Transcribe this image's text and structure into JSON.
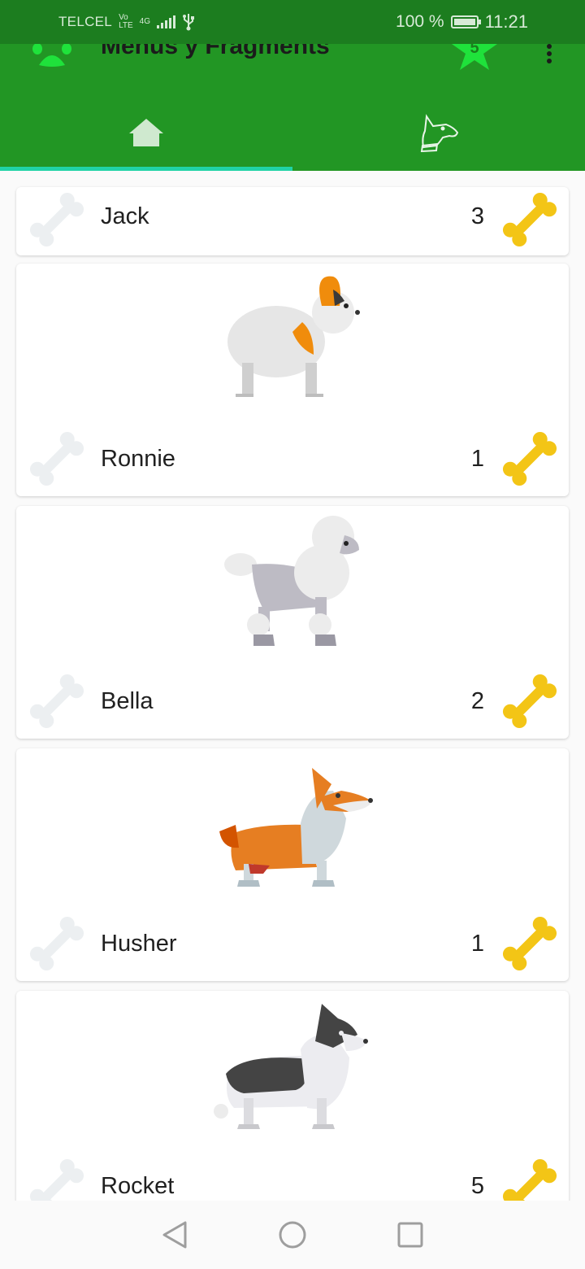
{
  "status_bar": {
    "carrier": "TELCEL",
    "volte_top": "Vo",
    "volte_bottom": "LTE",
    "network": "4G",
    "battery": "100 %",
    "time": "11:21"
  },
  "app_bar": {
    "title": "Menus y Fragments",
    "badge_count": "5",
    "tabs": [
      {
        "icon": "home-icon",
        "selected": true
      },
      {
        "icon": "dog-head-icon",
        "selected": false
      }
    ]
  },
  "colors": {
    "status_bar": "#1c7d1f",
    "app_bar": "#229624",
    "tab_indicator": "#20d3a6",
    "bone_active": "#f3c516",
    "bone_inactive": "#eceff1",
    "badge_star": "#1fe23b"
  },
  "dogs": [
    {
      "name": "Jack",
      "count": "3",
      "image": "none"
    },
    {
      "name": "Ronnie",
      "count": "1",
      "image": "papillon-icon"
    },
    {
      "name": "Bella",
      "count": "2",
      "image": "poodle-icon"
    },
    {
      "name": "Husher",
      "count": "1",
      "image": "corgi-icon"
    },
    {
      "name": "Rocket",
      "count": "5",
      "image": "border-collie-icon"
    }
  ],
  "nav": [
    "back-icon",
    "home-circle-icon",
    "recents-icon"
  ]
}
